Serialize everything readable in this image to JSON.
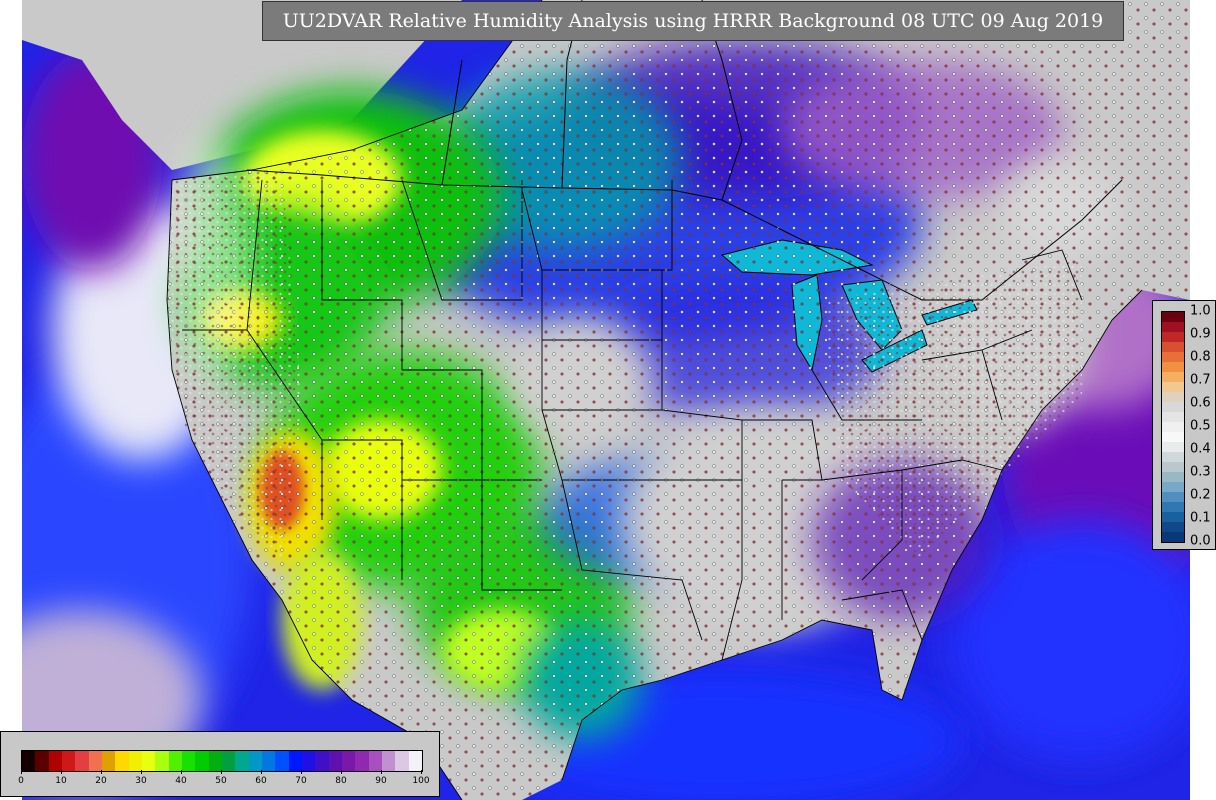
{
  "title": "UU2DVAR Relative Humidity Analysis using HRRR Background 08 UTC 09 Aug 2019",
  "rh_colorbar": {
    "ticks": [
      "0",
      "10",
      "20",
      "30",
      "40",
      "50",
      "60",
      "70",
      "80",
      "90",
      "100"
    ],
    "colors": [
      "#140000",
      "#5a0000",
      "#b00000",
      "#d01818",
      "#e24040",
      "#f07050",
      "#e0a000",
      "#ffd800",
      "#f0f000",
      "#e8ff10",
      "#a8ff10",
      "#50f000",
      "#18e000",
      "#00cc00",
      "#00b010",
      "#00a040",
      "#00a890",
      "#0098c8",
      "#0078e0",
      "#0050ff",
      "#0018ff",
      "#2010e8",
      "#4010c8",
      "#6010b0",
      "#7a18a8",
      "#9028b0",
      "#a850c0",
      "#c090d0",
      "#dcc8e4",
      "#f2f2f8"
    ]
  },
  "inc_colorbar": {
    "ticks": [
      "1.0",
      "0.9",
      "0.8",
      "0.7",
      "0.6",
      "0.5",
      "0.4",
      "0.3",
      "0.2",
      "0.1",
      "0.0"
    ],
    "colors": [
      "#6a0010",
      "#a01020",
      "#c02828",
      "#d85030",
      "#e87038",
      "#f09040",
      "#f4b060",
      "#f0c890",
      "#e0d0c0",
      "#d8d8d8",
      "#e4e4e4",
      "#f0f0f0",
      "#f8f8f8",
      "#e8ecec",
      "#d0d8dc",
      "#b8c8cc",
      "#98b8c4",
      "#78a8c8",
      "#5090c0",
      "#3078b0",
      "#1860a0",
      "#104888",
      "#083878"
    ]
  },
  "map": {
    "land_color": "#c8c8c8",
    "ocean_color": "#1a20e0",
    "deep_ocean_color": "#2a40ff",
    "great_lakes_color": "#10b8d8",
    "boundary_color": "#000000"
  }
}
